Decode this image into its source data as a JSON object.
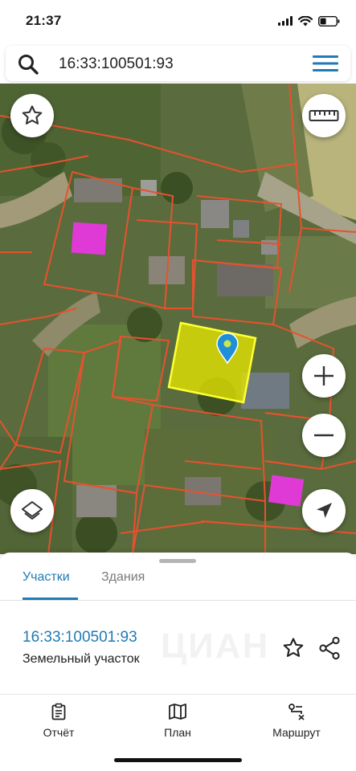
{
  "status_bar": {
    "time": "21:37"
  },
  "search": {
    "query": "16:33:100501:93"
  },
  "map": {
    "buttons": {
      "favorite": "star-icon",
      "ruler": "ruler-icon",
      "zoom_in": "plus-icon",
      "zoom_out": "minus-icon",
      "layers": "layers-icon",
      "locate": "navigation-arrow-icon"
    },
    "colors": {
      "boundary": "#e8512e",
      "selected_fill": "#e6e600",
      "selected_border": "#ffff33",
      "building": "#e03ad6",
      "pin": "#1f8fd8"
    }
  },
  "sheet": {
    "tabs": [
      {
        "label": "Участки",
        "active": true
      },
      {
        "label": "Здания",
        "active": false
      }
    ],
    "parcel": {
      "id": "16:33:100501:93",
      "type": "Земельный участок"
    },
    "watermark": "ЦИАН",
    "accent_color": "#1f7bb4"
  },
  "bottom_nav": {
    "items": [
      {
        "label": "Отчёт",
        "icon": "clipboard-icon"
      },
      {
        "label": "План",
        "icon": "map-icon"
      },
      {
        "label": "Маршрут",
        "icon": "route-icon"
      }
    ]
  }
}
